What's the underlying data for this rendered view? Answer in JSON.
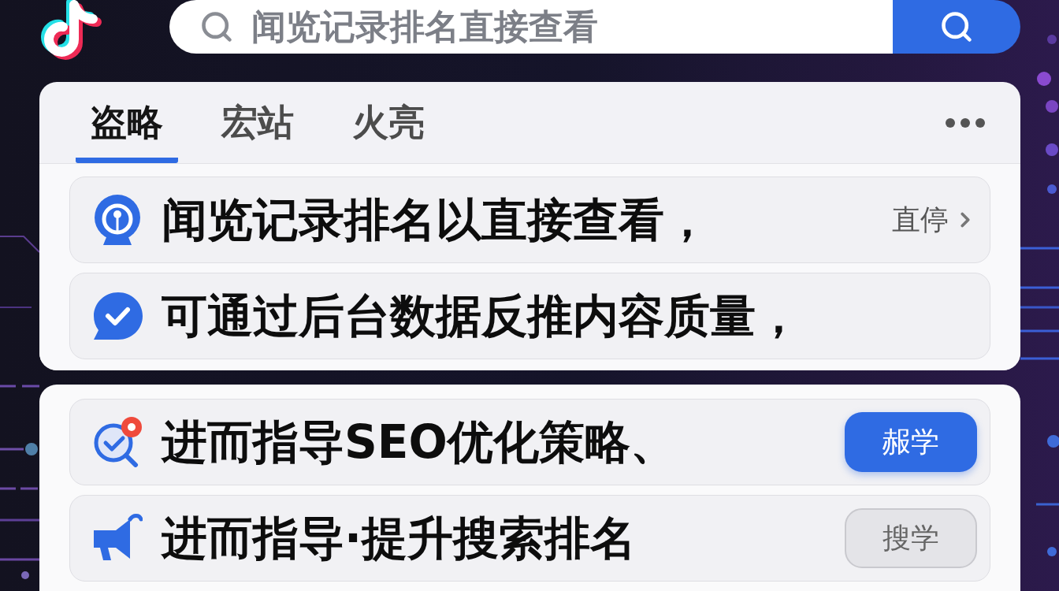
{
  "search": {
    "placeholder": "闻览记录排名直接查看"
  },
  "cards": [
    {
      "tabs": [
        {
          "label": "盗略",
          "selected": true
        },
        {
          "label": "宏站",
          "selected": false
        },
        {
          "label": "火亮",
          "selected": false
        }
      ],
      "rows": [
        {
          "kind": "link",
          "text": "闻览记录排名以直接查看，",
          "action": "直停"
        },
        {
          "kind": "plain",
          "text": "可通过后台数据反推内容质量，"
        }
      ]
    },
    {
      "rows": [
        {
          "kind": "button",
          "text": "进而指导SEO优化策略、",
          "action": "赧学",
          "active": true
        },
        {
          "kind": "button",
          "text": "进而指导·提升搜索排名",
          "action": "搜学",
          "active": false
        }
      ]
    }
  ]
}
